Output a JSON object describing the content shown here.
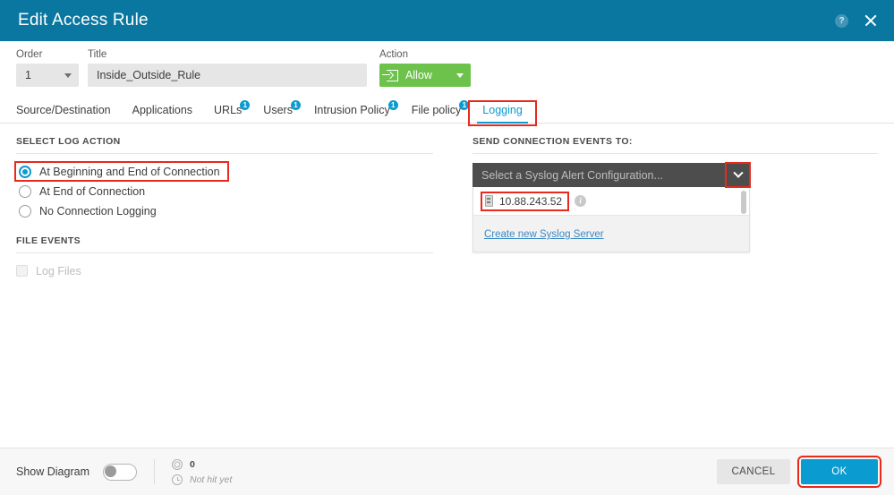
{
  "window": {
    "title": "Edit Access Rule",
    "help_icon": "help-circle-icon",
    "close_icon": "close-icon",
    "header_color": "#0a77a0"
  },
  "rule_header": {
    "order": {
      "label": "Order",
      "value": "1"
    },
    "title": {
      "label": "Title",
      "value": "Inside_Outside_Rule",
      "placeholder": ""
    },
    "action": {
      "label": "Action",
      "value": "Allow",
      "color": "#6cc24a",
      "icon": "allow-arrow-icon"
    }
  },
  "tabs": [
    {
      "label": "Source/Destination",
      "badge": "",
      "active": false
    },
    {
      "label": "Applications",
      "badge": "",
      "active": false
    },
    {
      "label": "URLs",
      "badge": "1",
      "active": false
    },
    {
      "label": "Users",
      "badge": "1",
      "active": false
    },
    {
      "label": "Intrusion Policy",
      "badge": "1",
      "active": false
    },
    {
      "label": "File policy",
      "badge": "1",
      "active": false
    },
    {
      "label": "Logging",
      "badge": "",
      "active": true,
      "highlighted": true
    }
  ],
  "left_panel": {
    "section_title": "SELECT LOG ACTION",
    "options": [
      {
        "label": "At Beginning and End of Connection",
        "selected": true,
        "highlighted": true
      },
      {
        "label": "At End of Connection",
        "selected": false,
        "highlighted": false
      },
      {
        "label": "No Connection Logging",
        "selected": false,
        "highlighted": false
      }
    ],
    "file_events": {
      "section_title": "FILE EVENTS",
      "checkbox_label": "Log Files",
      "checked": false,
      "disabled": true
    }
  },
  "right_panel": {
    "section_title": "SEND CONNECTION EVENTS TO:",
    "dropdown": {
      "placeholder": "Select a Syslog Alert Configuration...",
      "value": "",
      "open": true,
      "arrow_icon": "chevron-down-icon",
      "arrow_highlighted": true,
      "items": [
        {
          "label": "10.88.243.52",
          "icon": "syslog-server-icon",
          "info_icon": "info-icon",
          "highlighted": true
        }
      ],
      "footer_link": "Create new Syslog Server"
    }
  },
  "footer": {
    "show_diagram": {
      "label": "Show Diagram",
      "enabled": false
    },
    "hit_count": {
      "icon": "target-icon",
      "value": "0"
    },
    "hit_time": {
      "icon": "clock-icon",
      "text": "Not hit yet"
    },
    "cancel_label": "CANCEL",
    "ok_label": "OK",
    "ok_highlighted": true
  },
  "annotation_color": "#e8291c"
}
